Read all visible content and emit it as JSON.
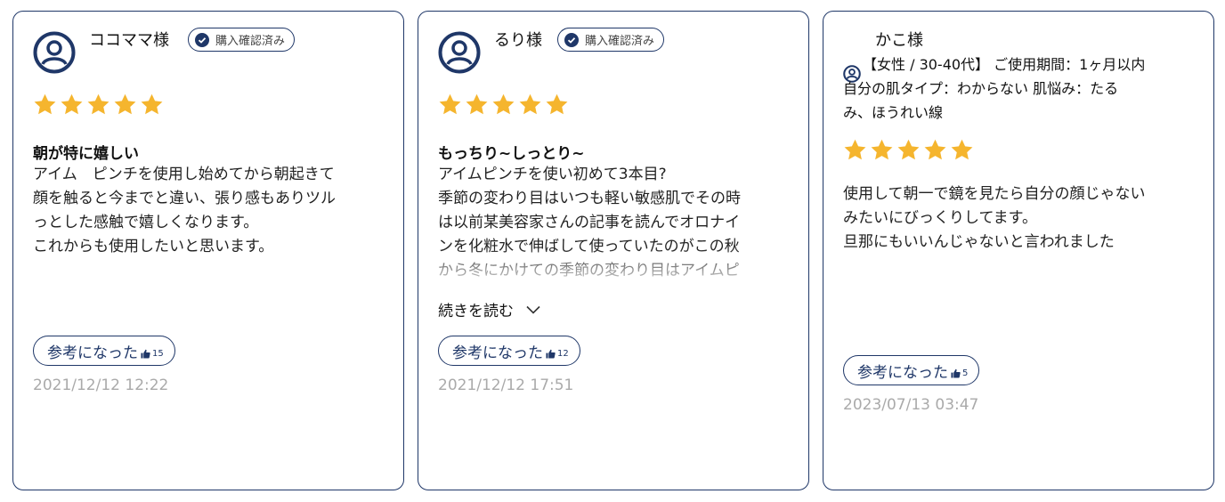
{
  "reviews": [
    {
      "name": "ココママ様",
      "verified_label": "購入確認済み",
      "rating": 5,
      "title": "朝が特に嬉しい",
      "body": "アイム　ピンチを使用し始めてから朝起きて\n顔を触ると今までと違い、張り感もありツル\nっとした感触で嬉しくなります。\nこれからも使用したいと思います。",
      "helpful_label": "参考になった",
      "helpful_count": "15",
      "date": "2021/12/12 12:22"
    },
    {
      "name": "るり様",
      "verified_label": "購入確認済み",
      "rating": 5,
      "title": "もっちり~しっとり~",
      "body": "アイムピンチを使い初めて3本目?\n季節の変わり目はいつも軽い敏感肌でその時\nは以前某美容家さんの記事を読んでオロナイ\nンを化粧水で伸ばして使っていたのがこの秋\nから冬にかけての季節の変わり目はアイムピ",
      "read_more_label": "続きを読む",
      "helpful_label": "参考になった",
      "helpful_count": "12",
      "date": "2021/12/12 17:51"
    },
    {
      "name": "かこ様",
      "meta": "【女性 / 30-40代】 ご使用期間：1ヶ月以内\n自分の肌タイプ：わからない 肌悩み：たる\nみ、ほうれい線",
      "rating": 5,
      "body": "使用して朝一で鏡を見たら自分の顔じゃない\nみたいにびっくりしてます。\n旦那にもいいんじゃないと言われました",
      "helpful_label": "参考になった",
      "helpful_count": "5",
      "date": "2023/07/13 03:47"
    }
  ],
  "colors": {
    "accent": "#1f3768",
    "star": "#f5b52e",
    "date": "#aaaaaa"
  }
}
